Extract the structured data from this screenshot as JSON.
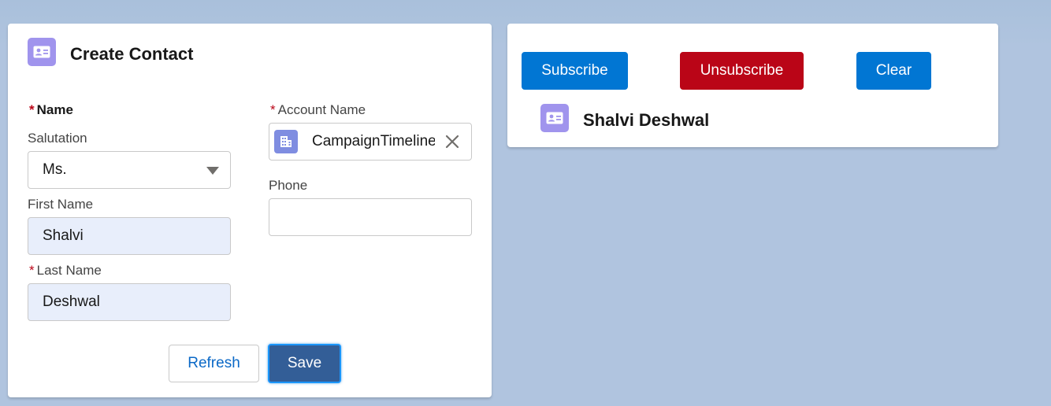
{
  "create_contact": {
    "title": "Create Contact",
    "icon": "contact-card-icon",
    "name_section_label": "Name",
    "salutation_label": "Salutation",
    "salutation_value": "Ms.",
    "first_name_label": "First Name",
    "first_name_value": "Shalvi",
    "last_name_label": "Last Name",
    "last_name_value": "Deshwal",
    "account_name_label": "Account Name",
    "account_name_value": "CampaignTimeline",
    "phone_label": "Phone",
    "phone_value": "",
    "refresh_label": "Refresh",
    "save_label": "Save",
    "required_marker": "*"
  },
  "subscription": {
    "subscribe_label": "Subscribe",
    "unsubscribe_label": "Unsubscribe",
    "clear_label": "Clear",
    "contact_name": "Shalvi Deshwal",
    "icon": "contact-card-icon"
  },
  "colors": {
    "background": "#b0c4df",
    "brand": "#0176d3",
    "destructive": "#ba0517",
    "contact_icon": "#a094ed",
    "account_icon": "#7f8de1",
    "save": "#335e97"
  }
}
